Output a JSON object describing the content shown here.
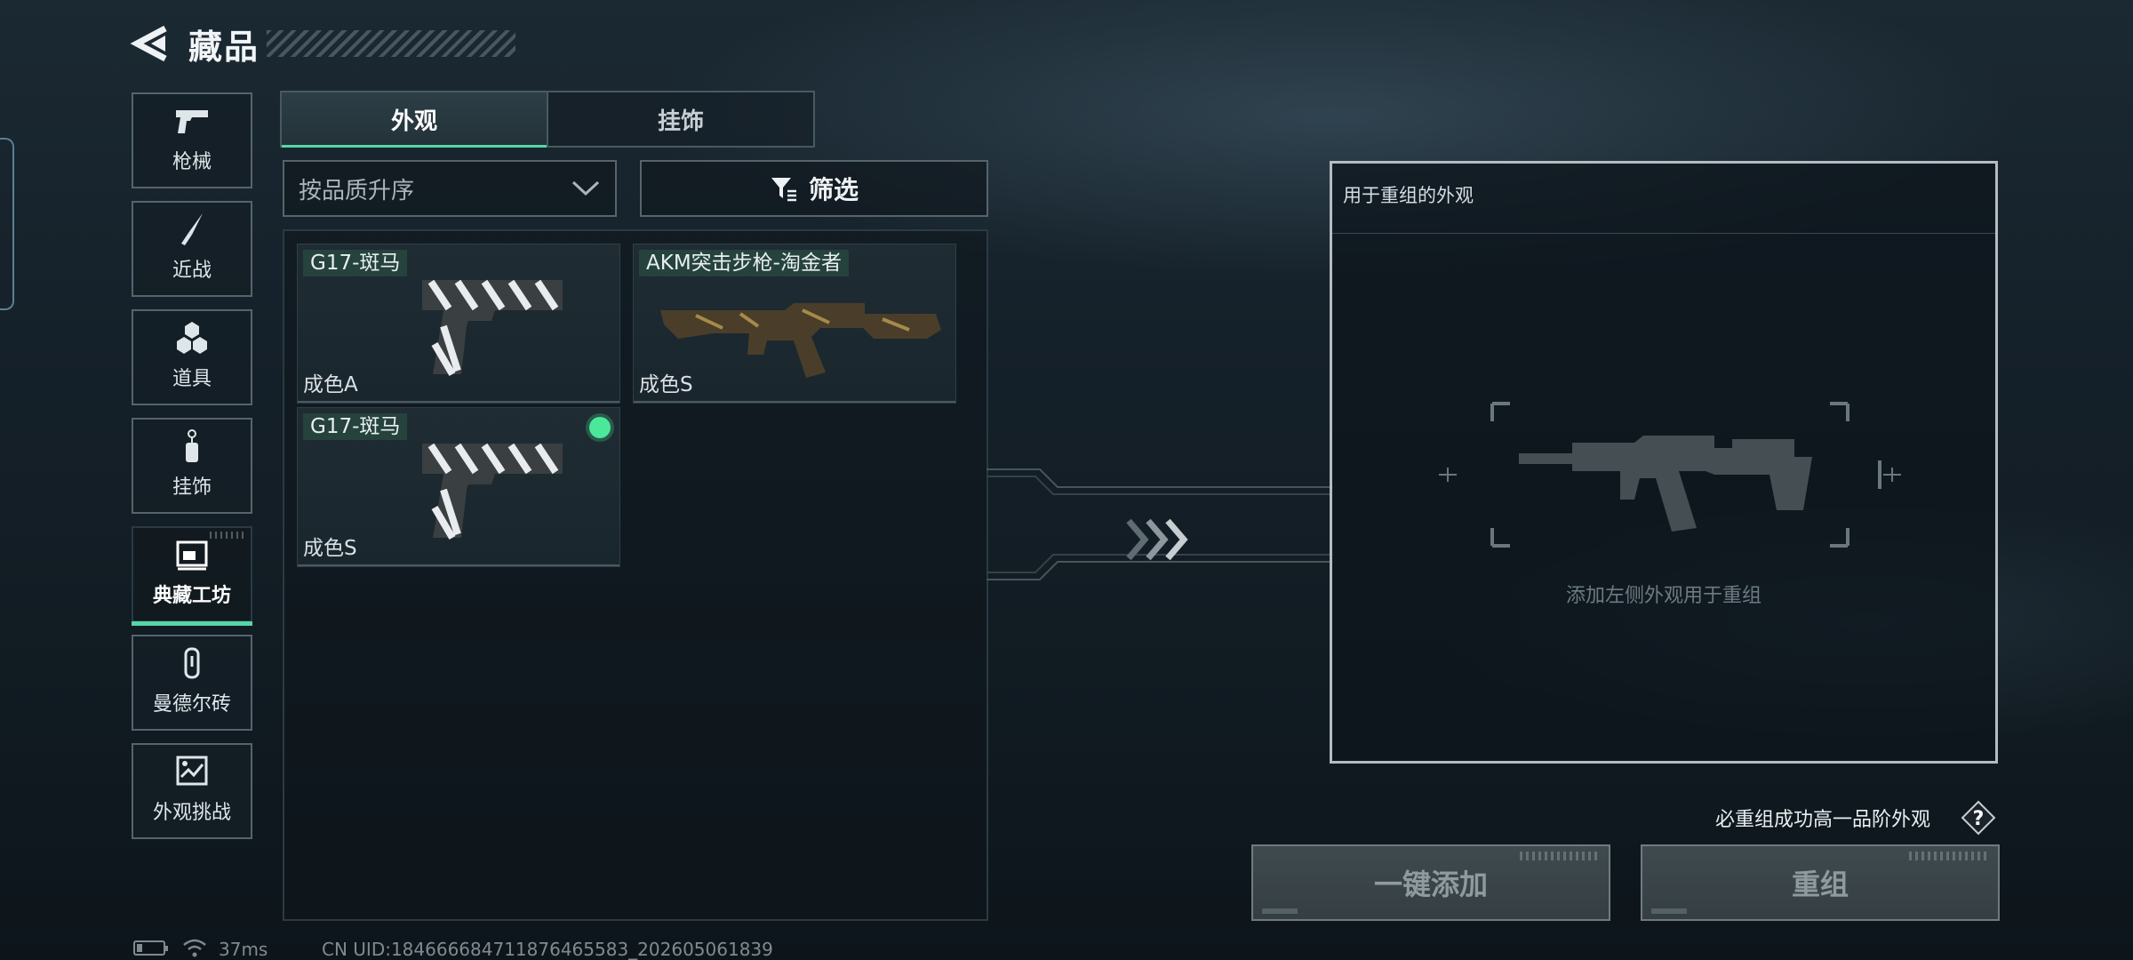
{
  "header": {
    "title": "藏品",
    "back_icon": "back-arrow-icon"
  },
  "sidebar": {
    "items": [
      {
        "label": "枪械",
        "icon": "pistol-icon",
        "active": false
      },
      {
        "label": "近战",
        "icon": "knife-icon",
        "active": false
      },
      {
        "label": "道具",
        "icon": "grenades-icon",
        "active": false
      },
      {
        "label": "挂饰",
        "icon": "charm-icon",
        "active": false
      },
      {
        "label": "典藏工坊",
        "icon": "workshop-icon",
        "active": true
      },
      {
        "label": "曼德尔砖",
        "icon": "brick-icon",
        "active": false
      },
      {
        "label": "外观挑战",
        "icon": "challenge-icon",
        "active": false
      }
    ]
  },
  "tabs": [
    {
      "label": "外观",
      "active": true
    },
    {
      "label": "挂饰",
      "active": false
    }
  ],
  "sort": {
    "value": "按品质升序"
  },
  "filter": {
    "label": "筛选"
  },
  "items": [
    {
      "name": "G17-斑马",
      "grade": "成色A",
      "selected": false
    },
    {
      "name": "AKM突击步枪-淘金者",
      "grade": "成色S",
      "selected": false
    },
    {
      "name": "G17-斑马",
      "grade": "成色S",
      "selected": true
    }
  ],
  "reorg_panel": {
    "title": "用于重组的外观",
    "empty_hint": "添加左侧外观用于重组"
  },
  "guarantee_text": "必重组成功高一品阶外观",
  "buttons": {
    "quick_add": "一键添加",
    "reorganize": "重组"
  },
  "status_bar": {
    "ping": "37ms",
    "uid": "CN UID:184666684711876465583_202605061839",
    "battery_level": 0.2
  },
  "colors": {
    "accent": "#56d6a8",
    "selected_dot": "#4ce89a",
    "panel_border": "#b3bcc1"
  }
}
